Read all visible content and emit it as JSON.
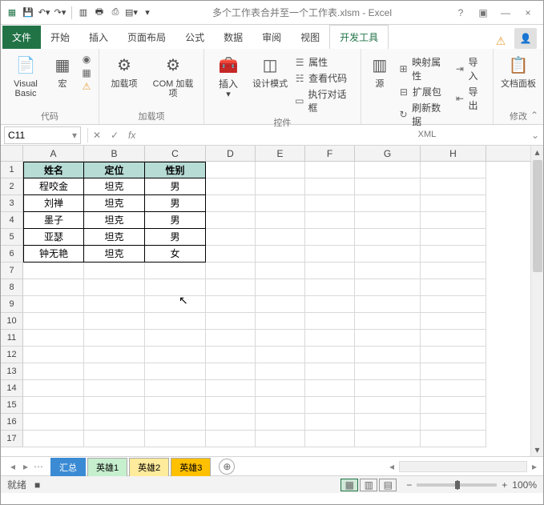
{
  "titlebar": {
    "title": "多个工作表合并至一个工作表.xlsm - Excel",
    "help": "?",
    "restore": "▭",
    "close": "×"
  },
  "tabs": {
    "file": "文件",
    "items": [
      "开始",
      "插入",
      "页面布局",
      "公式",
      "数据",
      "审阅",
      "视图",
      "开发工具"
    ]
  },
  "ribbon": {
    "group1": {
      "btn1": "Visual Basic",
      "btn2": "宏",
      "label": "代码"
    },
    "group2": {
      "btn1": "加载项",
      "btn2": "COM 加载项",
      "label": "加载项"
    },
    "group3": {
      "btn1": "插入",
      "btn2": "设计模式",
      "s1": "属性",
      "s2": "查看代码",
      "s3": "执行对话框",
      "label": "控件"
    },
    "group4": {
      "btn1": "源",
      "s1": "映射属性",
      "s2": "扩展包",
      "s3": "刷新数据",
      "s4": "导入",
      "s5": "导出",
      "label": "XML"
    },
    "group5": {
      "btn1": "文档面板",
      "label": "修改"
    }
  },
  "namebox": {
    "ref": "C11"
  },
  "columns": [
    "A",
    "B",
    "C",
    "D",
    "E",
    "F",
    "G",
    "H"
  ],
  "table": {
    "headers": [
      "姓名",
      "定位",
      "性别"
    ],
    "rows": [
      [
        "程咬金",
        "坦克",
        "男"
      ],
      [
        "刘禅",
        "坦克",
        "男"
      ],
      [
        "墨子",
        "坦克",
        "男"
      ],
      [
        "亚瑟",
        "坦克",
        "男"
      ],
      [
        "钟无艳",
        "坦克",
        "女"
      ]
    ]
  },
  "sheets": [
    "汇总",
    "英雄1",
    "英雄2",
    "英雄3"
  ],
  "status": {
    "ready": "就绪",
    "macro": "■",
    "zoom": "100%"
  }
}
